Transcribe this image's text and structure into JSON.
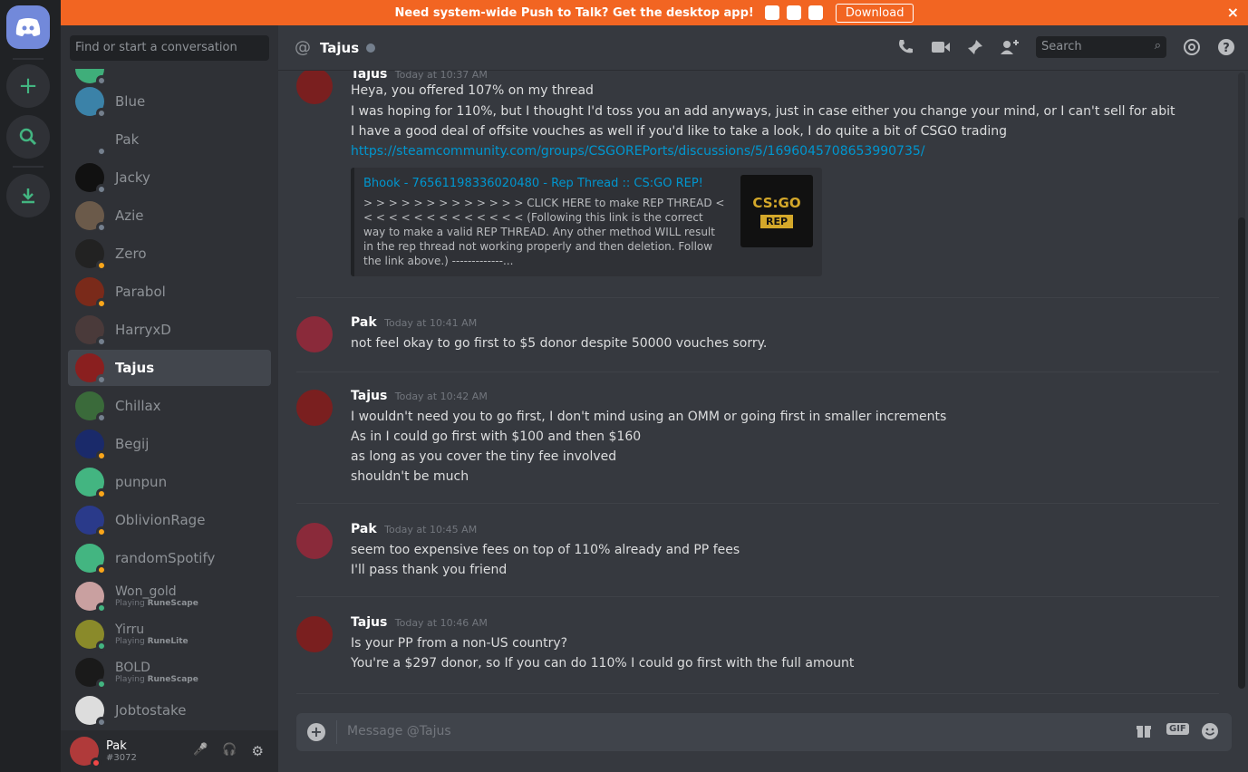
{
  "banner": {
    "text": "Need system-wide Push to Talk? Get the desktop app!",
    "download": "Download",
    "close": "×",
    "os_icons": [
      "apple-icon",
      "android-icon",
      "windows-icon"
    ]
  },
  "guild_bar": {
    "home_icon": "discord-logo-icon",
    "add_icon": "+",
    "search_icon": "⌕",
    "download_icon": "⤓"
  },
  "dm_sidebar": {
    "search_placeholder": "Find or start a conversation",
    "conversations": [
      {
        "name": "Blue",
        "status": "offline"
      },
      {
        "name": "Pak",
        "status": "offline"
      },
      {
        "name": "Jacky",
        "status": "offline"
      },
      {
        "name": "Azie",
        "status": "offline"
      },
      {
        "name": "Zero",
        "status": "idle"
      },
      {
        "name": "Parabol",
        "status": "idle"
      },
      {
        "name": "HarryxD",
        "status": "offline"
      },
      {
        "name": "Tajus",
        "status": "offline"
      },
      {
        "name": "Chillax",
        "status": "offline"
      },
      {
        "name": "Begij",
        "status": "idle"
      },
      {
        "name": "punpun",
        "status": "idle"
      },
      {
        "name": "OblivionRage",
        "status": "idle"
      },
      {
        "name": "randomSpotify",
        "status": "idle"
      },
      {
        "name": "Won_gold",
        "status": "online",
        "activity_prefix": "Playing",
        "activity": "RuneScape"
      },
      {
        "name": "Yirru",
        "status": "online",
        "activity_prefix": "Playing",
        "activity": "RuneLite"
      },
      {
        "name": "BOLD",
        "status": "online",
        "activity_prefix": "Playing",
        "activity": "RuneScape"
      },
      {
        "name": "Jobtostake",
        "status": "offline"
      }
    ],
    "active": "Tajus"
  },
  "user_panel": {
    "username": "Pak",
    "discriminator": "#3072",
    "mute_icon": "🎤",
    "deafen_icon": "🎧",
    "settings_icon": "⚙"
  },
  "header": {
    "at_symbol": "@",
    "channel": "Tajus",
    "search_placeholder": "Search",
    "icons": [
      "call-icon",
      "video-icon",
      "pin-icon",
      "add-friend-icon",
      "mention-icon",
      "help-icon"
    ]
  },
  "messages": [
    {
      "author": "Tajus",
      "time": "Today at 10:37 AM",
      "lines": [
        "Heya, you offered 107% on my thread",
        "I was hoping for 110%, but I thought I'd toss you an add anyways, just in case either you change your mind, or I can't sell for abit",
        "I have a good deal of offsite vouches as well if you'd like to take a look, I do quite a bit of CSGO trading"
      ],
      "link": "https://steamcommunity.com/groups/CSGOREPorts/discussions/5/1696045708653990735/",
      "embed": {
        "title": "Bhook - 76561198336020480 - Rep Thread :: CS:GO REP!",
        "description": "> > > > > > > > > > > > > CLICK HERE to make REP THREAD < < < < < < < < < < < < < < (Following this link is the correct way to make a valid REP THREAD. Any other method WILL result in the rep thread not working properly and then deletion. Follow the link above.) -------------...",
        "thumb_top": "CS:GO",
        "thumb_bottom": "REP"
      }
    },
    {
      "author": "Pak",
      "time": "Today at 10:41 AM",
      "lines": [
        "not feel okay to go first to $5 donor despite 50000 vouches sorry."
      ]
    },
    {
      "author": "Tajus",
      "time": "Today at 10:42 AM",
      "lines": [
        "I wouldn't need you to go first, I don't mind using an OMM or going first in smaller increments",
        "As in I could go first with $100 and then $160",
        "as long as you cover the tiny fee involved",
        "shouldn't be much"
      ]
    },
    {
      "author": "Pak",
      "time": "Today at 10:45 AM",
      "lines": [
        "seem too expensive fees on top of 110% already and PP fees",
        "I'll pass thank you friend"
      ]
    },
    {
      "author": "Tajus",
      "time": "Today at 10:46 AM",
      "lines": [
        "Is your PP from a non-US country?",
        "You're a $297 donor, so If you can do 110% I could go first with the full amount"
      ]
    }
  ],
  "composer": {
    "placeholder": "Message @Tajus",
    "gif_label": "GIF"
  },
  "colors": {
    "banner": "#f26522",
    "accent": "#7289da",
    "link": "#0096cf",
    "online": "#43b581",
    "idle": "#faa61a",
    "dnd": "#f04747"
  }
}
